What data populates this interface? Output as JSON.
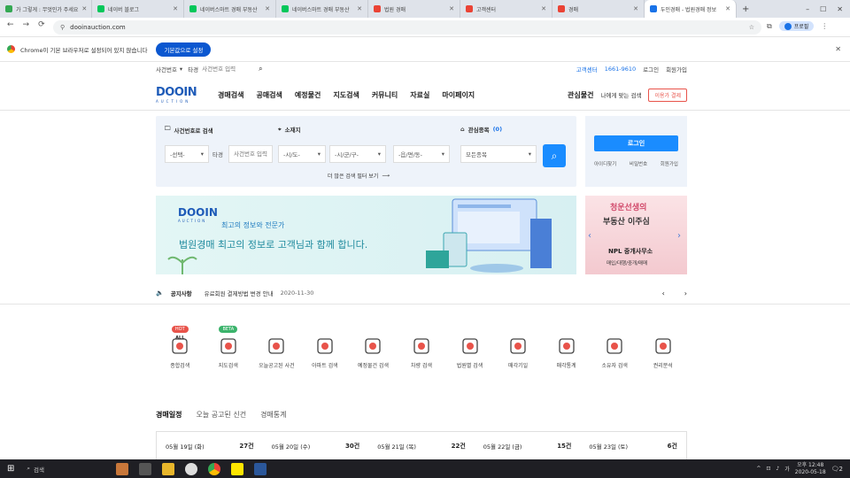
{
  "browser": {
    "tabs": [
      {
        "label": "가 그렇게 : 무엇인가 주세요",
        "color": "#34a853"
      },
      {
        "label": "네이버 블로그",
        "color": "#03c75a"
      },
      {
        "label": "네이버스마트 경매 부동산",
        "color": "#03c75a"
      },
      {
        "label": "네이버스마트 경매 부동산",
        "color": "#03c75a"
      },
      {
        "label": "법원 경매",
        "color": "#ea4335"
      },
      {
        "label": "고객센터",
        "color": "#ea4335"
      },
      {
        "label": "경매",
        "color": "#ea4335"
      },
      {
        "label": "두인경매 - 법원경매 정보",
        "color": "#1a73e8",
        "active": true
      }
    ],
    "new_tab": "+",
    "url": "dooinauction.com",
    "infobar_text": "Chrome이 기본 브라우저로 설정되어 있지 않습니다",
    "infobar_button": "기본값으로 설정",
    "profile": "프로필"
  },
  "site": {
    "top_search": {
      "select": "사건번호",
      "label": "타경",
      "placeholder": "사건번호 입력"
    },
    "util": {
      "center_label": "고객센터",
      "phone": "1661-9610",
      "login": "로그인",
      "join": "회원가입"
    },
    "logo": "DOOIN",
    "logo_sub": "AUCTION",
    "nav": [
      "경매검색",
      "공매검색",
      "예정물건",
      "지도검색",
      "커뮤니티",
      "자료실",
      "마이페이지"
    ],
    "nav_right": {
      "interest": "관심물건",
      "guide": "나에게 맞는 검색",
      "apply": "이용가 결제"
    },
    "search": {
      "case_title": "사건번호로 검색",
      "loc_title": "소재지",
      "interest_title": "관심종목",
      "interest_count": "(0)",
      "court": "-선택-",
      "tk": "타경",
      "case_placeholder": "사건번호 입력",
      "sido": "-시/도-",
      "sigungu": "-시/군/구-",
      "dong": "-읍/면/동-",
      "type": "모든종목",
      "detail": "더 많은 검색 필터 보기"
    },
    "login": {
      "button": "로그인",
      "find_id": "아이디찾기",
      "find_pw": "비밀번호",
      "join": "회원가입"
    },
    "banner": {
      "brand": "DOOIN",
      "brand_sub": "AUCTION",
      "tagline": "최고의 정보와 전문가",
      "headline": "법원경매 최고의 정보로 고객님과 함께 합니다."
    },
    "ad": {
      "line1": "청운선생의",
      "line2": "부동산 이주심",
      "line3": "NPL 중개사무소",
      "line4": "매입/대행/중개/매매"
    },
    "notice": {
      "label": "공지사항",
      "text": "유료회원 결제방법 변경 안내",
      "date": "2020-11-30"
    },
    "categories": [
      {
        "label": "종합검색",
        "badge": "HOT",
        "sub": "ALL",
        "color": "#e8534a"
      },
      {
        "label": "지도검색",
        "badge": "BETA",
        "color": "#e8534a"
      },
      {
        "label": "오늘공고된 사건",
        "color": "#e8534a"
      },
      {
        "label": "아파트 검색",
        "color": "#e8534a"
      },
      {
        "label": "예정물건 검색",
        "color": "#e8534a"
      },
      {
        "label": "차량 검색",
        "color": "#e8534a"
      },
      {
        "label": "법원별 검색",
        "color": "#e8534a"
      },
      {
        "label": "매각기일",
        "color": "#e8534a"
      },
      {
        "label": "매각통계",
        "color": "#e8534a"
      },
      {
        "label": "소유자 검색",
        "color": "#e8534a"
      },
      {
        "label": "권리분석",
        "color": "#e8534a"
      }
    ],
    "tabs": [
      "경매일정",
      "오늘 공고된 신건",
      "경매통계"
    ],
    "schedule": [
      {
        "date": "05월 19일 (화)",
        "count": "27건"
      },
      {
        "date": "05월 20일 (수)",
        "count": "30건"
      },
      {
        "date": "05월 21일 (목)",
        "count": "22건"
      },
      {
        "date": "05월 22일 (금)",
        "count": "15건"
      },
      {
        "date": "05월 23일 (토)",
        "count": "6건"
      }
    ]
  },
  "taskbar": {
    "search": "검색",
    "time": "오후 12:48",
    "date": "2020-05-18",
    "notif": "2"
  }
}
